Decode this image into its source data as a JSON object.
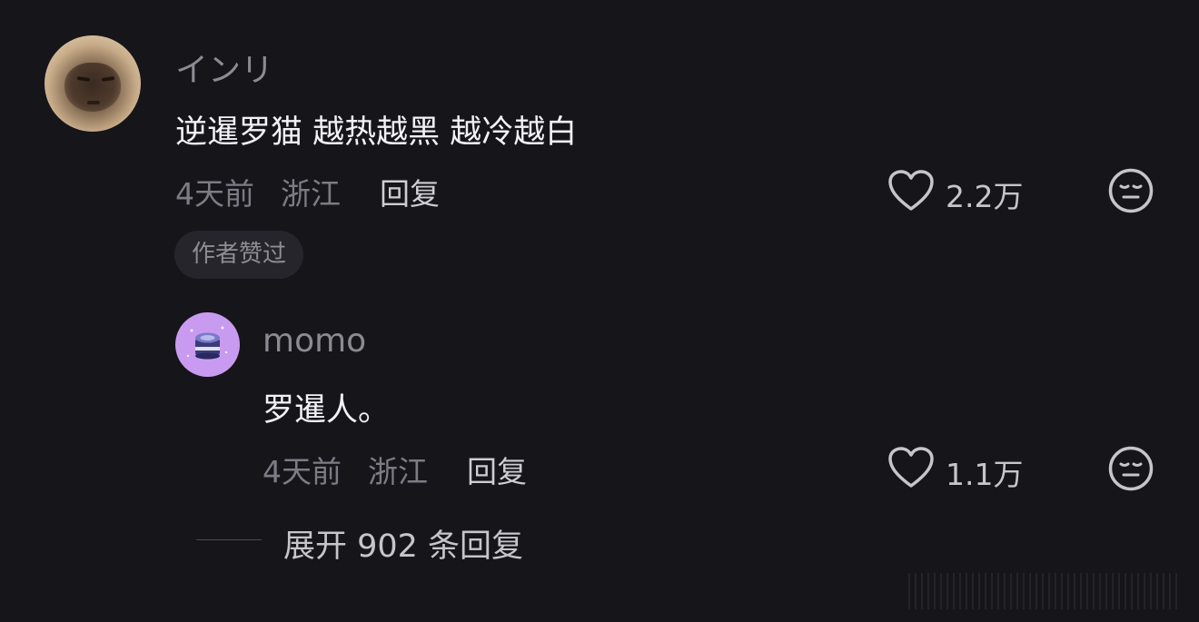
{
  "comment": {
    "username": "インリ",
    "text": "逆暹罗猫 越热越黑 越冷越白",
    "time": "4天前",
    "location": "浙江",
    "reply_label": "回复",
    "like_count": "2.2万",
    "badge": "作者赞过",
    "avatar_icon": "cat-avatar"
  },
  "reply": {
    "username": "momo",
    "text": "罗暹人。",
    "time": "4天前",
    "location": "浙江",
    "reply_label": "回复",
    "like_count": "1.1万",
    "avatar_icon": "jar-avatar"
  },
  "expand": {
    "label": "展开 902 条回复"
  },
  "colors": {
    "background": "#16151a",
    "primary_text": "#f2f2f4",
    "secondary_text": "#8c8a92",
    "badge_bg": "#26252b",
    "reply_avatar_bg": "#c89bf0"
  }
}
